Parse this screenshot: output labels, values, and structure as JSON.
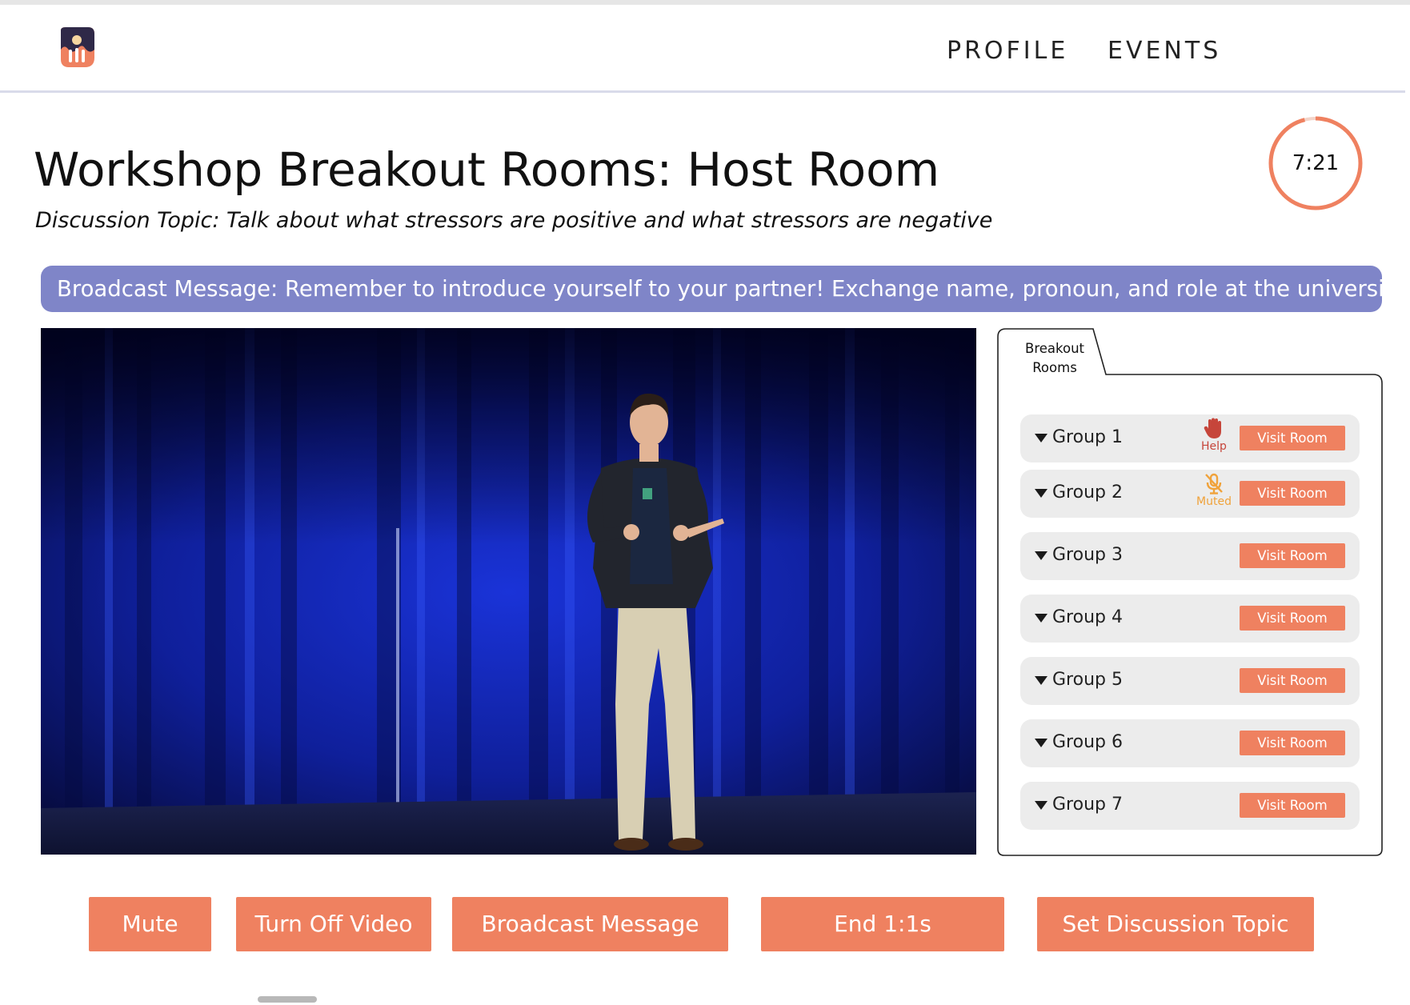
{
  "nav": {
    "links": [
      "PROFILE",
      "EVENTS"
    ]
  },
  "page": {
    "title": "Workshop Breakout Rooms: Host Room",
    "topic": "Discussion Topic: Talk about what stressors are positive and what stressors are negative",
    "timer": "7:21",
    "timer_progress": 0.96
  },
  "broadcast": {
    "text": "Broadcast Message: Remember to introduce yourself to your partner! Exchange name, pronoun, and role at the university!"
  },
  "rooms": {
    "tab_label": "Breakout Rooms",
    "visit_label": "Visit Room",
    "groups": [
      {
        "name": "Group 1",
        "status": "Help",
        "status_icon": "raised-hand-icon"
      },
      {
        "name": "Group 2",
        "status": "Muted",
        "status_icon": "muted-microphone-icon"
      },
      {
        "name": "Group 3",
        "status": ""
      },
      {
        "name": "Group 4",
        "status": ""
      },
      {
        "name": "Group 5",
        "status": ""
      },
      {
        "name": "Group 6",
        "status": ""
      },
      {
        "name": "Group 7",
        "status": ""
      }
    ]
  },
  "actions": [
    "Mute",
    "Turn Off Video",
    "Broadcast Message",
    "End 1:1s",
    "Set Discussion Topic"
  ],
  "colors": {
    "accent": "#ef8160",
    "broadcast_bg": "#7f85c8",
    "timer_ring": "#ef8160",
    "help": "#c6453a",
    "muted": "#f0a23a",
    "logo_dark": "#2f2948",
    "logo_orange": "#ef8160"
  }
}
